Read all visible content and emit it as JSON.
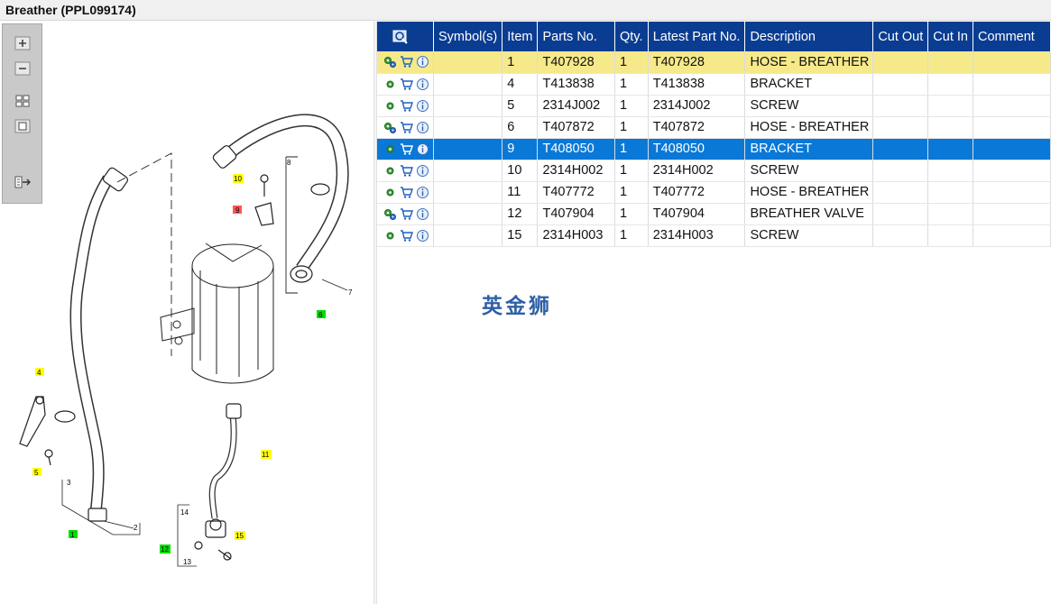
{
  "window": {
    "title": "Breather (PPL099174)"
  },
  "toolbar": {
    "buttons": [
      {
        "name": "zoom-in-icon"
      },
      {
        "name": "zoom-out-icon"
      },
      {
        "name": "fit-page-icon"
      },
      {
        "name": "actual-size-icon"
      },
      {
        "name": "export-icon"
      }
    ]
  },
  "diagram": {
    "callouts": [
      "10",
      "9",
      "8",
      "7",
      "6",
      "4",
      "5",
      "3",
      "2",
      "1",
      "11",
      "14",
      "12",
      "13",
      "15"
    ]
  },
  "table": {
    "columns": [
      "Symbol(s)",
      "Item",
      "Parts No.",
      "Qty.",
      "Latest Part No.",
      "Description",
      "Cut Out",
      "Cut In",
      "Comment"
    ],
    "rows": [
      {
        "item": "1",
        "part": "T407928",
        "qty": "1",
        "latest": "T407928",
        "desc": "HOSE - BREATHER",
        "state": "highlighted"
      },
      {
        "item": "4",
        "part": "T413838",
        "qty": "1",
        "latest": "T413838",
        "desc": "BRACKET",
        "state": ""
      },
      {
        "item": "5",
        "part": "2314J002",
        "qty": "1",
        "latest": "2314J002",
        "desc": "SCREW",
        "state": ""
      },
      {
        "item": "6",
        "part": "T407872",
        "qty": "1",
        "latest": "T407872",
        "desc": "HOSE - BREATHER",
        "state": ""
      },
      {
        "item": "9",
        "part": "T408050",
        "qty": "1",
        "latest": "T408050",
        "desc": "BRACKET",
        "state": "selected"
      },
      {
        "item": "10",
        "part": "2314H002",
        "qty": "1",
        "latest": "2314H002",
        "desc": "SCREW",
        "state": ""
      },
      {
        "item": "11",
        "part": "T407772",
        "qty": "1",
        "latest": "T407772",
        "desc": "HOSE - BREATHER",
        "state": ""
      },
      {
        "item": "12",
        "part": "T407904",
        "qty": "1",
        "latest": "T407904",
        "desc": "BREATHER VALVE",
        "state": ""
      },
      {
        "item": "15",
        "part": "2314H003",
        "qty": "1",
        "latest": "2314H003",
        "desc": "SCREW",
        "state": ""
      }
    ]
  },
  "watermark": "英金狮",
  "colors": {
    "header": "#0a3d91",
    "highlight": "#f6e98a",
    "selected": "#0a78d7",
    "callout_yellow": "#ffff00",
    "callout_green": "#00dd00",
    "callout_red": "#ff5555"
  }
}
